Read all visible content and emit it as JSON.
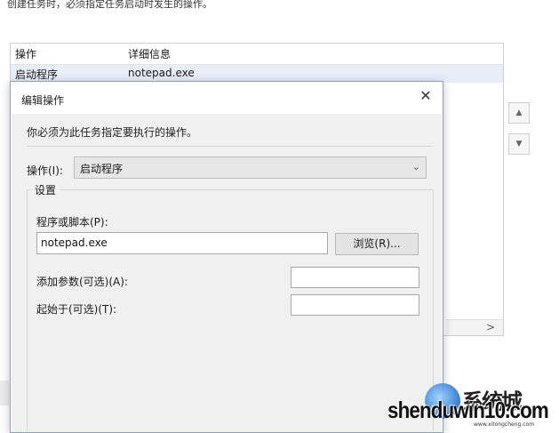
{
  "background": {
    "description": "创建任务时，必须指定任务启动时发生的操作。",
    "table": {
      "headers": [
        "操作",
        "详细信息"
      ],
      "rows": [
        {
          "action": "启动程序",
          "details": "notepad.exe"
        }
      ]
    },
    "scroll_right_arrow": ">",
    "move_up_arrow": "▲",
    "move_down_arrow": "▼"
  },
  "dialog": {
    "title": "编辑操作",
    "close_glyph": "✕",
    "instruction": "你必须为此任务指定要执行的操作。",
    "action_label": "操作(I):",
    "action_value": "启动程序",
    "chevron": "⌄",
    "settings_legend": "设置",
    "program_label": "程序或脚本(P):",
    "program_value": "notepad.exe",
    "browse_label": "浏览(R)...",
    "args_label": "添加参数(可选)(A):",
    "args_value": "",
    "start_label": "起始于(可选)(T):",
    "start_value": ""
  },
  "watermark": {
    "chinese": "系统城",
    "text": "shenduwin10.com",
    "small": "www.xitongcheng.com"
  }
}
